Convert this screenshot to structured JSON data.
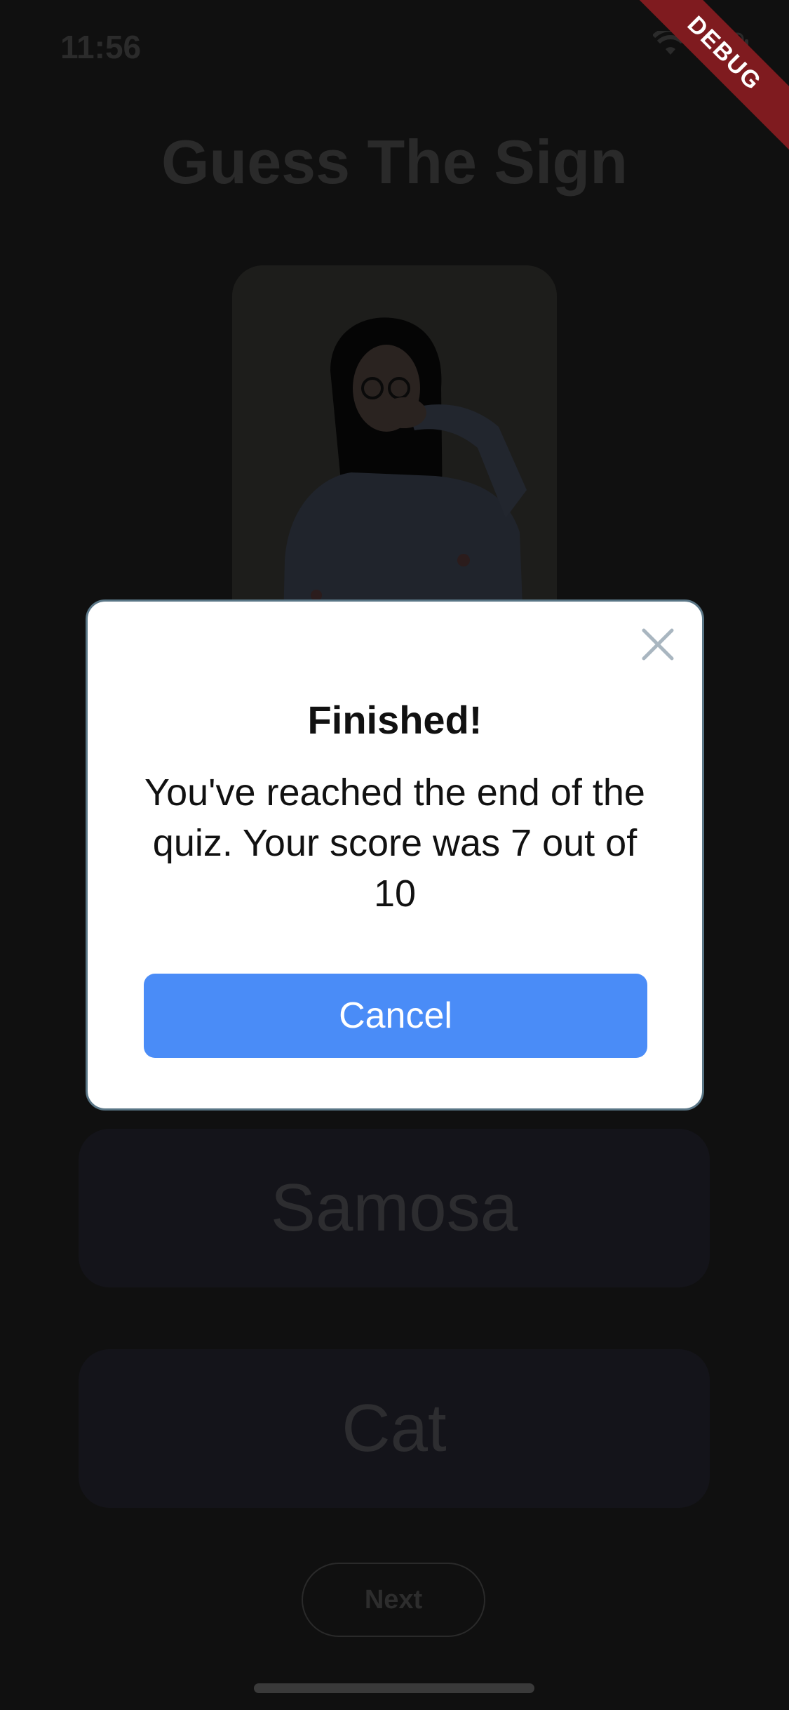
{
  "status_bar": {
    "time": "11:56"
  },
  "debug_banner": "DEBUG",
  "page": {
    "title": "Guess The Sign"
  },
  "options": [
    {
      "label": "Samosa"
    },
    {
      "label": "Cat"
    }
  ],
  "next_label": "Next",
  "dialog": {
    "title": "Finished!",
    "message": "You've reached the end of the quiz. Your score was 7 out of 10",
    "cancel_label": "Cancel"
  },
  "colors": {
    "dialog_button": "#4a8cf7",
    "debug_ribbon": "#7f1b1f",
    "dialog_border": "#5a7686"
  }
}
